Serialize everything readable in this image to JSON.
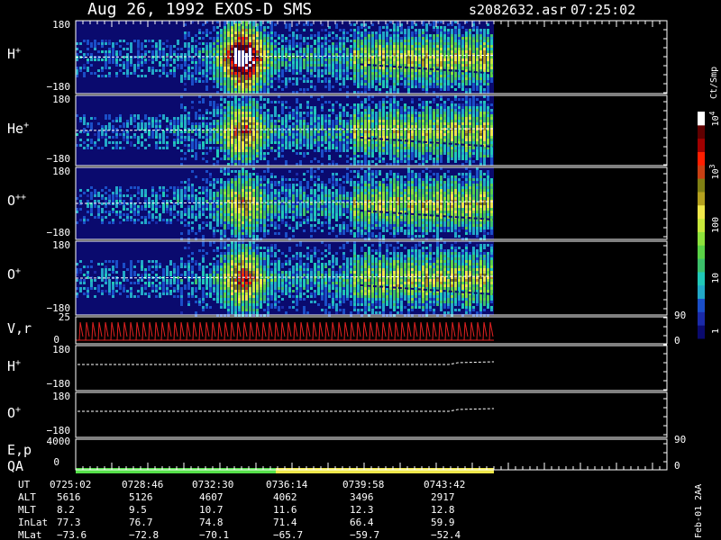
{
  "header": {
    "title": "Aug 26, 1992   EXOS-D SMS",
    "filename": "s2082632.asr",
    "time": "07:25:02"
  },
  "panels": [
    {
      "id": "h",
      "label": "H",
      "sup": "+",
      "ytop": "180",
      "ybot": "−180"
    },
    {
      "id": "he",
      "label": "He",
      "sup": "+",
      "ytop": "180",
      "ybot": "−180"
    },
    {
      "id": "opp",
      "label": "O",
      "sup": "++",
      "ytop": "180",
      "ybot": "−180"
    },
    {
      "id": "o",
      "label": "O",
      "sup": "+",
      "ytop": "180",
      "ybot": "−180"
    }
  ],
  "vr_panel": {
    "label": "V,r",
    "ytop": "25",
    "ybot": "0",
    "rtop": "90",
    "rbot": "0"
  },
  "line_panels": [
    {
      "id": "h_line",
      "label": "H",
      "sup": "+",
      "ytop": "180",
      "ybot": "−180"
    },
    {
      "id": "o_line",
      "label": "O",
      "sup": "+",
      "ytop": "180",
      "ybot": "−180"
    }
  ],
  "ep_panel": {
    "label1": "E,p",
    "label2": "QA",
    "ytop": "4000",
    "ybot": "0",
    "rtop": "90",
    "rbot": "0"
  },
  "colorbar": {
    "unit": "Ct/Smp",
    "ticks": [
      {
        "label": "1",
        "value": 1
      },
      {
        "label": "10",
        "value": 10
      },
      {
        "label": "100",
        "value": 100
      },
      {
        "label": "10",
        "sup": "3",
        "value": 1000
      },
      {
        "label": "10",
        "sup": "4",
        "value": 10000
      }
    ]
  },
  "footer": {
    "rows": [
      {
        "name": "UT",
        "values": [
          "0725:02",
          "0728:46",
          "0732:30",
          "0736:14",
          "0739:58",
          "0743:42"
        ]
      },
      {
        "name": "ALT",
        "values": [
          "5616",
          "5126",
          "4607",
          "4062",
          "3496",
          "2917"
        ]
      },
      {
        "name": "MLT",
        "values": [
          "8.2",
          "9.5",
          "10.7",
          "11.6",
          "12.3",
          "12.8"
        ]
      },
      {
        "name": "InLat",
        "values": [
          "77.3",
          "76.7",
          "74.8",
          "71.4",
          "66.4",
          "59.9"
        ]
      },
      {
        "name": "MLat",
        "values": [
          "−73.6",
          "−72.8",
          "−70.1",
          "−65.7",
          "−59.7",
          "−52.4"
        ]
      }
    ]
  },
  "side_stamp": "Feb-01 2AA",
  "chart_data": {
    "type": "heatmap",
    "title": "Aug 26, 1992   EXOS-D SMS",
    "x": [
      "0725:02",
      "0728:46",
      "0732:30",
      "0736:14",
      "0739:58",
      "0743:42"
    ],
    "series": [
      {
        "name": "H+",
        "ylim": [
          -180,
          180
        ]
      },
      {
        "name": "He+",
        "ylim": [
          -180,
          180
        ]
      },
      {
        "name": "O++",
        "ylim": [
          -180,
          180
        ]
      },
      {
        "name": "O+",
        "ylim": [
          -180,
          180
        ]
      },
      {
        "name": "V,r",
        "ylim": [
          0,
          25
        ]
      },
      {
        "name": "E,p",
        "ylim": [
          0,
          4000
        ]
      }
    ],
    "colorscale": {
      "log": true,
      "range": [
        1,
        10000
      ],
      "unit": "Ct/Smp"
    },
    "qa_colors": [
      "#55e04a",
      "#f0e84a"
    ]
  }
}
